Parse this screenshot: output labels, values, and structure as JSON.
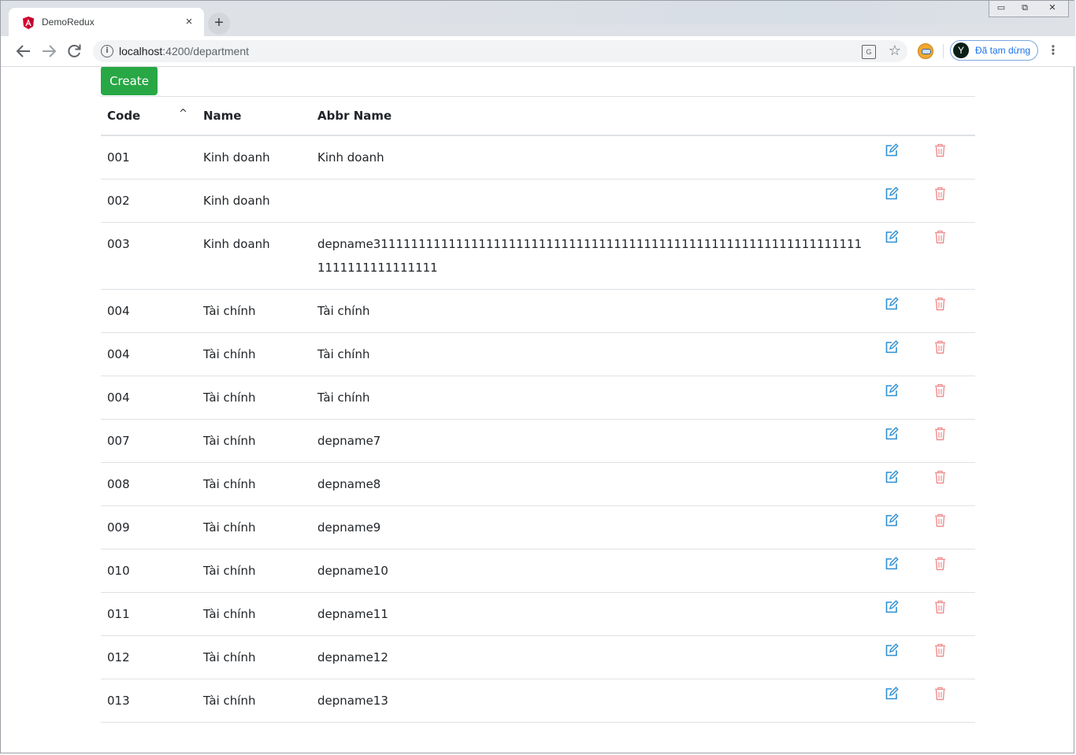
{
  "browser": {
    "tab_title": "DemoRedux",
    "tab_close": "×",
    "new_tab": "+",
    "url_host": "localhost",
    "url_path": ":4200/department",
    "profile_initial": "Y",
    "profile_label": "Đã tạm dừng",
    "window_controls": {
      "minimize": "▭",
      "maximize": "⧉",
      "close": "✕"
    },
    "icons": {
      "favicon": "angular-icon",
      "back": "arrow-left-icon",
      "forward": "arrow-right-icon",
      "reload": "reload-icon",
      "info": "info-icon",
      "translate": "translate-icon",
      "bookmark": "star-icon",
      "extension": "extension-icon",
      "menu": "kebab-menu-icon"
    }
  },
  "page": {
    "create_label": "Create",
    "columns": {
      "code": "Code",
      "name": "Name",
      "abbr": "Abbr Name",
      "sort_indicator": "^"
    },
    "colors": {
      "create_bg": "#28a745",
      "edit_icon": "#2e8fd3",
      "delete_icon": "#f08c8c"
    },
    "rows": [
      {
        "code": "001",
        "name": "Kinh doanh",
        "abbr": "Kinh doanh"
      },
      {
        "code": "002",
        "name": "Kinh doanh",
        "abbr": ""
      },
      {
        "code": "003",
        "name": "Kinh doanh",
        "abbr": "depname311111111111111111111111111111111111111111111111111111111111111111111111111111111"
      },
      {
        "code": "004",
        "name": "Tài chính",
        "abbr": "Tài chính"
      },
      {
        "code": "004",
        "name": "Tài chính",
        "abbr": "Tài chính"
      },
      {
        "code": "004",
        "name": "Tài chính",
        "abbr": "Tài chính"
      },
      {
        "code": "007",
        "name": "Tài chính",
        "abbr": "depname7"
      },
      {
        "code": "008",
        "name": "Tài chính",
        "abbr": "depname8"
      },
      {
        "code": "009",
        "name": "Tài chính",
        "abbr": "depname9"
      },
      {
        "code": "010",
        "name": "Tài chính",
        "abbr": "depname10"
      },
      {
        "code": "011",
        "name": "Tài chính",
        "abbr": "depname11"
      },
      {
        "code": "012",
        "name": "Tài chính",
        "abbr": "depname12"
      },
      {
        "code": "013",
        "name": "Tài chính",
        "abbr": "depname13"
      }
    ]
  }
}
